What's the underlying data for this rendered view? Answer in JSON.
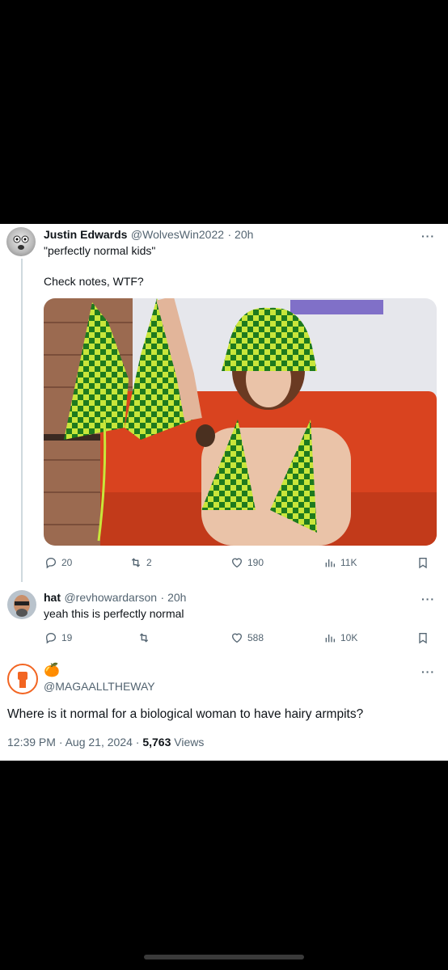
{
  "tweet1": {
    "name": "Justin Edwards",
    "handle": "@WolvesWin2022",
    "time": "· 20h",
    "line1": "\"perfectly normal kids\"",
    "line2": "Check notes, WTF?",
    "replies": "20",
    "retweets": "2",
    "likes": "190",
    "views": "11K"
  },
  "tweet2": {
    "name": "hat",
    "handle": "@revhowardarson",
    "time": "· 20h",
    "text": "yeah this is perfectly normal",
    "replies": "19",
    "likes": "588",
    "views": "10K"
  },
  "main_tweet": {
    "emoji": "🍊",
    "handle": "@MAGAALLTHEWAY",
    "text": "Where is it normal for a biological woman to have hairy armpits?",
    "timestamp": "12:39 PM · Aug 21, 2024 · ",
    "views_count": "5,763",
    "views_label": " Views"
  },
  "more_label": "···",
  "colors": {
    "accent_orange": "#f26522",
    "muted": "#536471",
    "divider": "#cfd9de"
  }
}
